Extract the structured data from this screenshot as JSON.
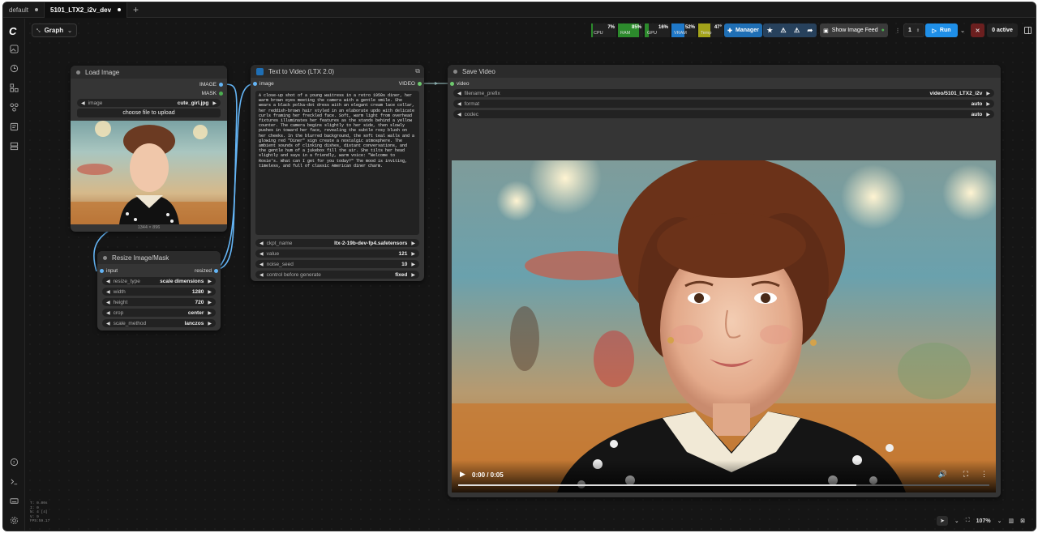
{
  "tabs": [
    {
      "label": "default",
      "active": false
    },
    {
      "label": "5101_LTX2_i2v_dev",
      "active": true
    }
  ],
  "tab_add_icon": "plus-icon",
  "toolbar": {
    "graph_label": "Graph",
    "monitors": [
      {
        "label": "CPU",
        "pct": "7%",
        "value": 0.07,
        "color": "#2c8a2c"
      },
      {
        "label": "RAM",
        "pct": "85%",
        "value": 0.85,
        "color": "#2c8a2c"
      },
      {
        "label": "GPU",
        "pct": "16%",
        "value": 0.16,
        "color": "#2c8a2c"
      },
      {
        "label": "VRAM",
        "pct": "52%",
        "value": 0.52,
        "color": "#1f78c8"
      },
      {
        "label": "Temp",
        "pct": "47°",
        "value": 0.47,
        "color": "#a3a31a"
      }
    ],
    "manager_label": "Manager",
    "image_feed_label": "Show Image Feed",
    "queue_count": "1",
    "run_label": "Run",
    "active_label": "0 active"
  },
  "nodes": {
    "load_image": {
      "title": "Load Image",
      "outputs": [
        "IMAGE",
        "MASK"
      ],
      "image_widget": {
        "label": "image",
        "value": "cute_girl.jpg"
      },
      "upload_label": "choose file to upload",
      "dimensions": "1344 × 896"
    },
    "resize": {
      "title": "Resize Image/Mask",
      "input": "input",
      "output": "resized",
      "widgets": [
        {
          "label": "resize_type",
          "value": "scale dimensions"
        },
        {
          "label": "width",
          "value": "1280"
        },
        {
          "label": "height",
          "value": "720"
        },
        {
          "label": "crop",
          "value": "center"
        },
        {
          "label": "scale_method",
          "value": "lanczos"
        }
      ]
    },
    "text_to_video": {
      "title": "Text to Video (LTX 2.0)",
      "input": "image",
      "output": "VIDEO",
      "prompt": "A close-up shot of a young waitress in a retro 1950s diner, her warm brown eyes meeting the camera with a gentle smile. She wears a black polka-dot dress with an elegant cream lace collar, her reddish-brown hair styled in an elaborate updo with delicate curls framing her freckled face. Soft, warm light from overhead fixtures illuminates her features as the stands behind a yellow counter. The camera begins slightly to her side, then slowly pushes in toward her face, revealing the subtle rosy blush on her cheeks. In the blurred background, the soft teal walls and a glowing red \"Diner\" sign create a nostalgic atmosphere. The ambient sounds of clinking dishes, distant conversations, and the gentle hum of a jukebox fill the air. She tilts her head slightly and says in a friendly, warm voice: \"Welcome to Rosie's. What can I get for you today?\" The mood is inviting, timeless, and full of classic American diner charm.",
      "widgets": [
        {
          "label": "ckpt_name",
          "value": "ltx-2-19b-dev-fp4.safetensors"
        },
        {
          "label": "value",
          "value": "121"
        },
        {
          "label": "noise_seed",
          "value": "10"
        },
        {
          "label": "control before generate",
          "value": "fixed"
        }
      ]
    },
    "save_video": {
      "title": "Save Video",
      "input": "video",
      "widgets": [
        {
          "label": "filename_prefix",
          "value": "video/5101_LTX2_i2v"
        },
        {
          "label": "format",
          "value": "auto"
        },
        {
          "label": "codec",
          "value": "auto"
        }
      ],
      "time": "0:00 / 0:05",
      "progress": 0.75
    }
  },
  "stats": [
    "T: 0.00s",
    "I: 0",
    "N: 4 [4]",
    "V: 9",
    "FPS:59.17"
  ],
  "zoom": "107%",
  "colors": {
    "accent": "#1f8fe8",
    "image_link": "#64b5f6",
    "video_link": "#6ec96e"
  }
}
